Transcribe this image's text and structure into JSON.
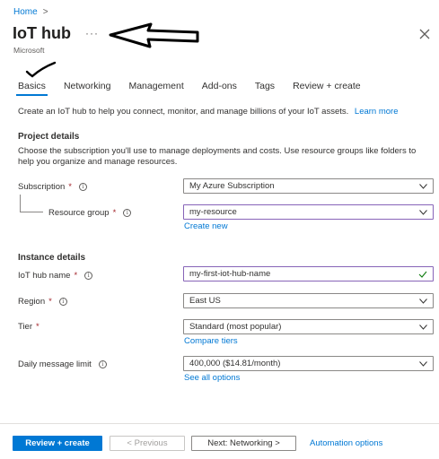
{
  "breadcrumb": {
    "home": "Home",
    "chevron": ">"
  },
  "header": {
    "title": "IoT hub",
    "ellipsis": "···",
    "subtitle": "Microsoft"
  },
  "tabs": [
    {
      "label": "Basics",
      "active": true
    },
    {
      "label": "Networking"
    },
    {
      "label": "Management"
    },
    {
      "label": "Add-ons"
    },
    {
      "label": "Tags"
    },
    {
      "label": "Review + create"
    }
  ],
  "intro": {
    "text": "Create an IoT hub to help you connect, monitor, and manage billions of your IoT assets.",
    "link": "Learn more"
  },
  "project": {
    "heading": "Project details",
    "description": "Choose the subscription you'll use to manage deployments and costs. Use resource groups like folders to help you organize and manage resources.",
    "subscription": {
      "label": "Subscription",
      "value": "My Azure Subscription"
    },
    "resource_group": {
      "label": "Resource group",
      "value": "my-resource",
      "create_link": "Create new"
    }
  },
  "instance": {
    "heading": "Instance details",
    "hub_name": {
      "label": "IoT hub name",
      "value": "my-first-iot-hub-name"
    },
    "region": {
      "label": "Region",
      "value": "East US"
    },
    "tier": {
      "label": "Tier",
      "value": "Standard (most popular)",
      "link": "Compare tiers"
    },
    "daily_limit": {
      "label": "Daily message limit",
      "value": "400,000 ($14.81/month)",
      "link": "See all options"
    }
  },
  "footer": {
    "review_create": "Review + create",
    "previous": "< Previous",
    "next": "Next: Networking >",
    "automation": "Automation options"
  },
  "colors": {
    "accent": "#0078d4",
    "required": "#a4262c",
    "focus": "#8764b8",
    "valid": "#107c10"
  }
}
